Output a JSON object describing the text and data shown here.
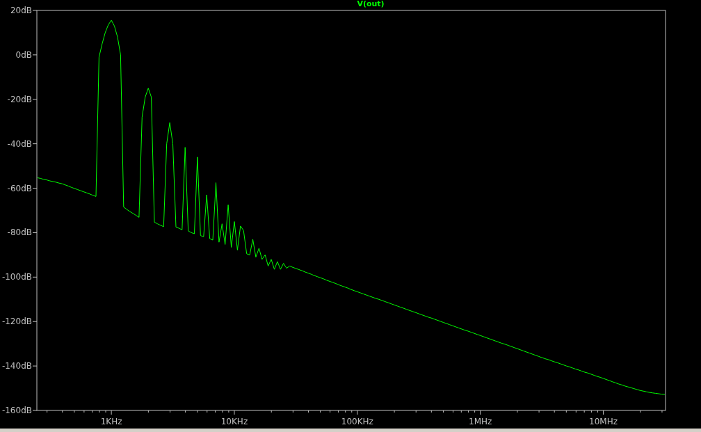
{
  "plot": {
    "chart_data": {
      "type": "line",
      "categories": [
        null,
        null,
        null,
        null,
        null,
        null,
        null,
        null,
        null,
        null,
        null,
        null,
        null,
        null,
        null,
        null,
        null,
        null,
        null,
        null,
        null,
        null,
        null,
        null,
        "1KHz",
        null,
        null,
        null,
        null,
        null,
        null,
        null,
        null,
        null,
        null,
        null,
        null,
        null,
        null,
        null,
        null,
        null,
        null,
        null,
        null,
        null,
        null,
        null,
        null,
        null,
        null,
        null,
        null,
        null,
        null,
        null,
        null,
        null,
        null,
        null,
        null,
        null,
        null,
        null,
        "10KHz",
        null,
        null,
        null,
        null,
        null,
        null,
        null,
        null,
        null,
        null,
        null,
        null,
        null,
        null,
        null,
        null,
        null,
        null,
        null,
        null,
        null,
        null,
        null,
        null,
        null,
        null,
        null,
        null,
        null,
        null,
        null,
        null,
        null,
        null,
        null,
        null,
        null,
        null,
        null,
        "100KHz",
        null,
        null,
        null,
        null,
        null,
        null,
        null,
        null,
        null,
        null,
        null,
        null,
        null,
        null,
        null,
        null,
        null,
        null,
        null,
        null,
        null,
        null,
        null,
        null,
        null,
        null,
        null,
        null,
        null,
        null,
        null,
        null,
        null,
        null,
        null,
        null,
        null,
        null,
        null,
        "1MHz",
        null,
        null,
        null,
        null,
        null,
        null,
        null,
        null,
        null,
        null,
        null,
        null,
        null,
        null,
        null,
        null,
        null,
        null,
        null,
        null,
        null,
        null,
        null,
        null,
        null,
        null,
        null,
        null,
        null,
        null,
        null,
        null,
        null,
        null,
        null,
        null,
        null,
        null,
        null,
        "10MHz",
        null,
        null,
        null,
        null,
        null,
        null,
        null,
        null,
        null,
        null,
        null,
        null,
        null,
        null,
        null,
        null,
        null,
        null,
        null,
        null
      ],
      "series": [
        {
          "name": "V(out)",
          "color": "#00ff00",
          "values": [
            -55.3,
            -55.6,
            -56.0,
            -56.3,
            -56.7,
            -57.0,
            -57.3,
            -57.7,
            -58.0,
            -58.5,
            -59.0,
            -59.6,
            -60.1,
            -60.6,
            -61.1,
            -61.6,
            -62.1,
            -62.6,
            -63.2,
            -63.7,
            -1,
            5,
            10,
            13.5,
            15.6,
            13,
            8,
            0,
            -68.5,
            -69.5,
            -70.5,
            -71.3,
            -72.2,
            -73.1,
            -28,
            -19,
            -15,
            -19,
            -75.3,
            -76,
            -76.7,
            -77.3,
            -40,
            -30.5,
            -40,
            -77.5,
            -78,
            -78.7,
            -41.6,
            -79.2,
            -80,
            -80.5,
            -46,
            -81.3,
            -81.8,
            -63,
            -82.7,
            -83.3,
            -57.5,
            -84.3,
            -76,
            -85.3,
            -67.5,
            -86.6,
            -75,
            -87.8,
            -77,
            -79,
            -89.5,
            -90,
            -83,
            -91,
            -87,
            -92,
            -90,
            -95,
            -92,
            -96.5,
            -93,
            -96.5,
            -93.8,
            -96,
            -95,
            -95.6,
            -96.1,
            -96.6,
            -97.1,
            -97.7,
            -98.2,
            -98.7,
            -99.3,
            -99.8,
            -100.3,
            -100.8,
            -101.4,
            -101.9,
            -102.4,
            -102.9,
            -103.5,
            -104.0,
            -104.5,
            -105.0,
            -105.6,
            -106.1,
            -106.6,
            -107.1,
            -107.6,
            -108.1,
            -108.6,
            -109.1,
            -109.6,
            -110.0,
            -110.5,
            -111.0,
            -111.5,
            -112.0,
            -112.5,
            -113.0,
            -113.5,
            -114.0,
            -114.5,
            -115.0,
            -115.5,
            -116.0,
            -116.5,
            -117.0,
            -117.5,
            -118.0,
            -118.4,
            -118.9,
            -119.4,
            -119.9,
            -120.4,
            -120.9,
            -121.4,
            -121.9,
            -122.4,
            -122.9,
            -123.4,
            -123.9,
            -124.3,
            -124.8,
            -125.3,
            -125.8,
            -126.3,
            -126.8,
            -127.3,
            -127.8,
            -128.3,
            -128.8,
            -129.3,
            -129.8,
            -130.2,
            -130.7,
            -131.2,
            -131.7,
            -132.2,
            -132.7,
            -133.2,
            -133.7,
            -134.2,
            -134.7,
            -135.2,
            -135.7,
            -136.2,
            -136.7,
            -137.1,
            -137.6,
            -138.1,
            -138.5,
            -139.0,
            -139.5,
            -140.0,
            -140.4,
            -140.9,
            -141.4,
            -141.8,
            -142.3,
            -142.8,
            -143.2,
            -143.7,
            -144.2,
            -144.7,
            -145.1,
            -145.6,
            -146.1,
            -146.6,
            -147.1,
            -147.6,
            -148.1,
            -148.5,
            -149.0,
            -149.4,
            -149.8,
            -150.2,
            -150.6,
            -151.0,
            -151.3,
            -151.6,
            -151.9,
            -152.1,
            -152.3,
            -152.5,
            -152.7,
            -152.8
          ]
        }
      ],
      "ylim": [
        -160,
        20
      ],
      "yticks": [
        {
          "value": 20,
          "label": "20dB"
        },
        {
          "value": 0,
          "label": "0dB"
        },
        {
          "value": -20,
          "label": "-20dB"
        },
        {
          "value": -40,
          "label": "-40dB"
        },
        {
          "value": -60,
          "label": "-60dB"
        },
        {
          "value": -80,
          "label": "-80dB"
        },
        {
          "value": -100,
          "label": "-100dB"
        },
        {
          "value": -120,
          "label": "-120dB"
        },
        {
          "value": -140,
          "label": "-140dB"
        },
        {
          "value": -160,
          "label": "-160dB"
        }
      ]
    }
  }
}
